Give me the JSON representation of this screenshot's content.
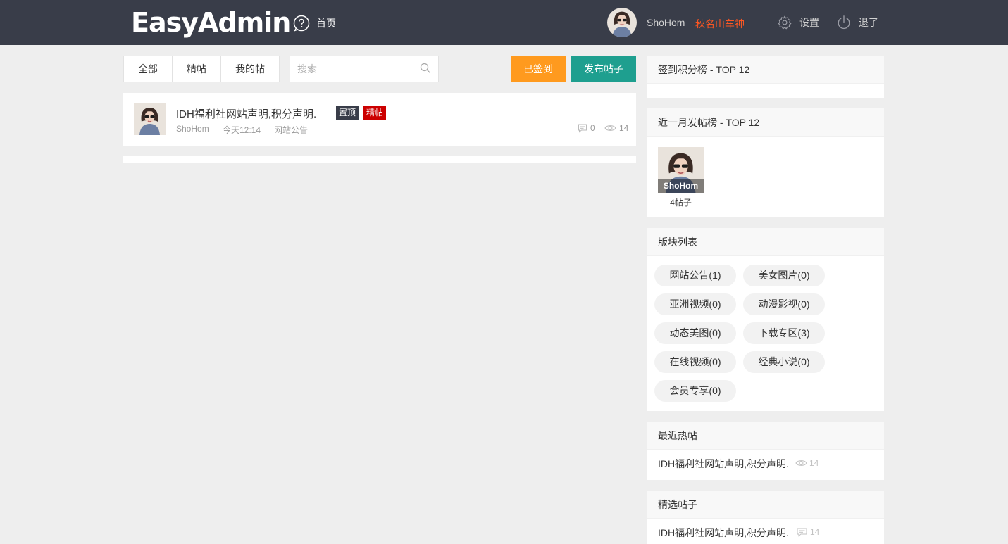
{
  "header": {
    "logo": "EasyAdmin",
    "home_label": "首页",
    "user_name": "ShoHom",
    "user_title": "秋名山车神",
    "settings_label": "设置",
    "logout_label": "退了"
  },
  "toolbar": {
    "tabs": [
      "全部",
      "精帖",
      "我的帖"
    ],
    "search_placeholder": "搜索",
    "signed_label": "已签到",
    "post_label": "发布帖子"
  },
  "posts": [
    {
      "title": "IDH福利社网站声明,积分声明.",
      "badges": [
        "置顶",
        "精帖"
      ],
      "author": "ShoHom",
      "time": "今天12:14",
      "category": "网站公告",
      "replies": "0",
      "views": "14"
    }
  ],
  "sidebar": {
    "sign_rank_title": "签到积分榜 - TOP 12",
    "month_rank_title": "近一月发帖榜 - TOP 12",
    "month_rank": [
      {
        "name": "ShoHom",
        "count": "4帖子"
      }
    ],
    "blocks_title": "版块列表",
    "blocks": [
      "网站公告(1)",
      "美女图片(0)",
      "亚洲视频(0)",
      "动漫影视(0)",
      "动态美图(0)",
      "下载专区(3)",
      "在线视频(0)",
      "经典小说(0)",
      "会员专享(0)"
    ],
    "hot_title": "最近热帖",
    "hot_item": {
      "title": "IDH福利社网站声明,积分声明.",
      "views": "14"
    },
    "chosen_title": "精选帖子",
    "chosen_item": {
      "title": "IDH福利社网站声明,积分声明.",
      "replies": "14"
    }
  }
}
